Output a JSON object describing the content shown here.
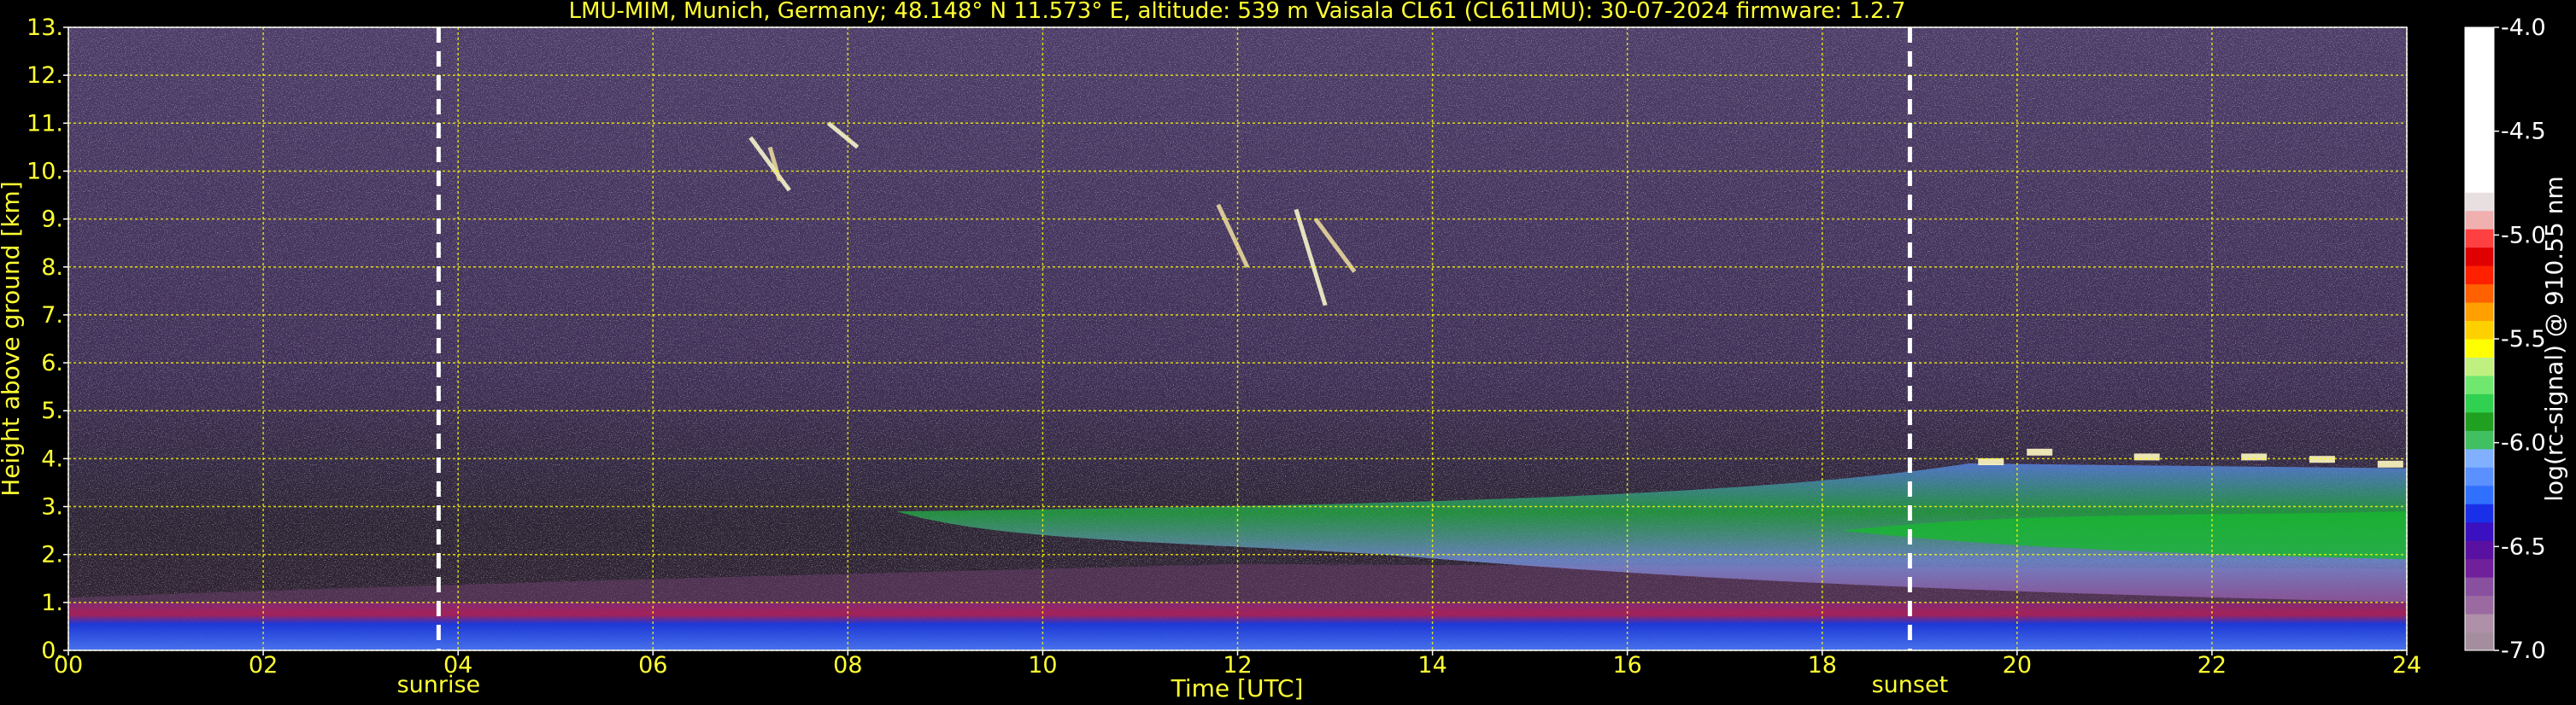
{
  "title": "LMU-MIM, Munich, Germany; 48.148° N 11.573° E, altitude: 539 m    Vaisala CL61 (CL61LMU): 30-07-2024    firmware: 1.2.7",
  "chart_data": {
    "type": "heatmap",
    "xlabel": "Time [UTC]",
    "ylabel": "Height above ground [km]",
    "xlim": [
      0,
      24
    ],
    "ylim": [
      0,
      13
    ],
    "x_ticks": [
      "00",
      "02",
      "04",
      "06",
      "08",
      "10",
      "12",
      "14",
      "16",
      "18",
      "20",
      "22",
      "24"
    ],
    "y_ticks": [
      "0.",
      "1.",
      "2.",
      "3.",
      "4.",
      "5.",
      "6.",
      "7.",
      "8.",
      "9.",
      "10.",
      "11.",
      "12.",
      "13."
    ],
    "grid": true,
    "grid_color": "#ffff00",
    "markers": [
      {
        "label": "sunrise",
        "time": 3.8
      },
      {
        "label": "sunset",
        "time": 18.9
      }
    ],
    "colorbar": {
      "label": "log(rc-signal) @ 910.55 nm",
      "range": [
        -7.0,
        -4.0
      ],
      "ticks": [
        "-7.0",
        "-6.5",
        "-6.0",
        "-5.5",
        "-5.0",
        "-4.5",
        "-4.0"
      ],
      "colors": [
        "#a48e9e",
        "#b090a8",
        "#9a6aa0",
        "#8a50a0",
        "#70209a",
        "#5a10a0",
        "#3a10c0",
        "#1a30e8",
        "#3070ff",
        "#5a90ff",
        "#80b0ff",
        "#40c060",
        "#20a020",
        "#30d050",
        "#70e870",
        "#c0f080",
        "#ffff00",
        "#ffd000",
        "#ffa000",
        "#ff6000",
        "#ff2000",
        "#e00000",
        "#ff4040",
        "#f0b0b0",
        "#e8e0e0",
        "#ffffff"
      ]
    },
    "features": [
      {
        "name": "aerosol boundary layer",
        "x": [
          0,
          24
        ],
        "y_top": [
          1.0,
          1.0
        ]
      },
      {
        "name": "residual/elevated layer",
        "x": [
          8,
          24
        ],
        "y_top": [
          3.0,
          3.8
        ]
      },
      {
        "name": "cirrus",
        "x": [
          7.0,
          8.2
        ],
        "y": [
          9.5,
          11.0
        ]
      },
      {
        "name": "cirrus",
        "x": [
          11.6,
          13.4
        ],
        "y": [
          7.1,
          9.3
        ]
      },
      {
        "name": "convective cloud tops",
        "x": [
          19.5,
          24
        ],
        "y": [
          3.6,
          4.2
        ]
      }
    ]
  }
}
